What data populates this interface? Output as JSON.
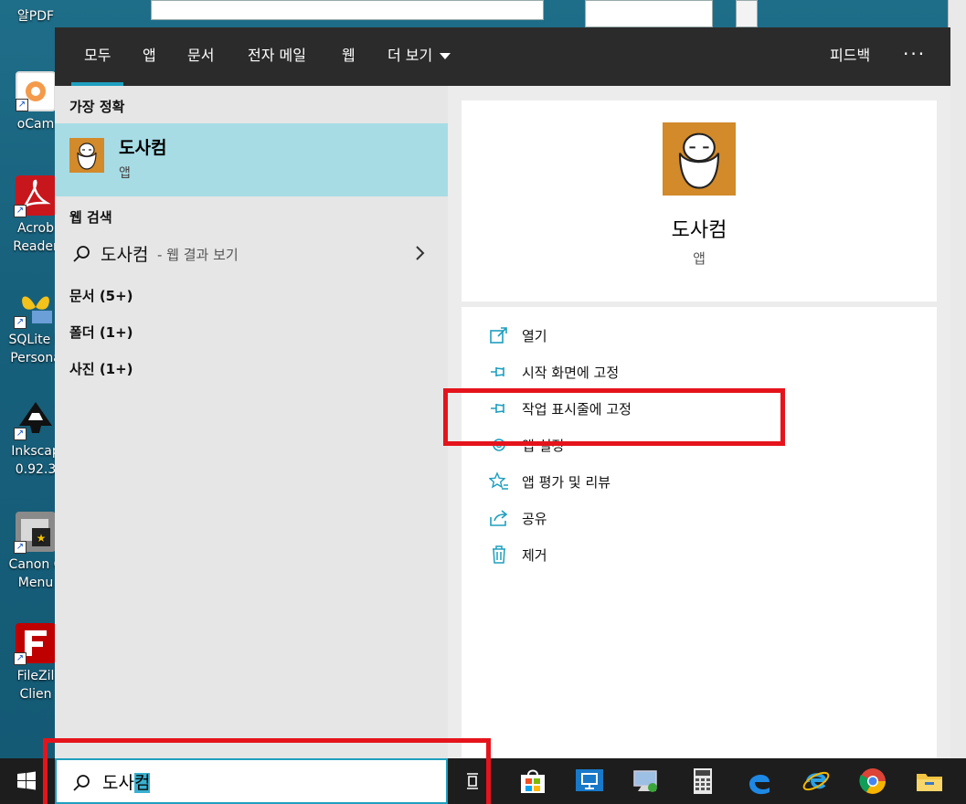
{
  "desktop": {
    "icons": [
      {
        "label1": "알PDF",
        "label2": ""
      },
      {
        "label1": "oCam",
        "label2": ""
      },
      {
        "label1": "Acrob",
        "label2": "Reader"
      },
      {
        "label1": "SQLite E",
        "label2": "Persona"
      },
      {
        "label1": "Inkscap",
        "label2": "0.92.3"
      },
      {
        "label1": "Canon C",
        "label2": "Menu"
      },
      {
        "label1": "FileZil",
        "label2": "Clien"
      }
    ]
  },
  "tabs": {
    "all": "모두",
    "apps": "앱",
    "documents": "문서",
    "email": "전자 메일",
    "web": "웹",
    "more": "더 보기",
    "feedback": "피드백",
    "dots": "···"
  },
  "left": {
    "best_match_header": "가장 정확",
    "best_title": "도사컴",
    "best_sub": "앱",
    "web_header": "웹 검색",
    "web_query": "도사컴",
    "web_hint": "- 웹 결과 보기",
    "categories": [
      "문서 (5+)",
      "폴더 (1+)",
      "사진 (1+)"
    ]
  },
  "detail": {
    "title": "도사컴",
    "sub": "앱",
    "actions": [
      "열기",
      "시작 화면에 고정",
      "작업 표시줄에 고정",
      "앱 설정",
      "앱 평가 및 리뷰",
      "공유",
      "제거"
    ]
  },
  "search": {
    "typed": "도사",
    "selected": "컴"
  },
  "colors": {
    "accent": "#1e9fbf",
    "highlight": "#e5141c",
    "selection_bg": "#a7dce5"
  }
}
